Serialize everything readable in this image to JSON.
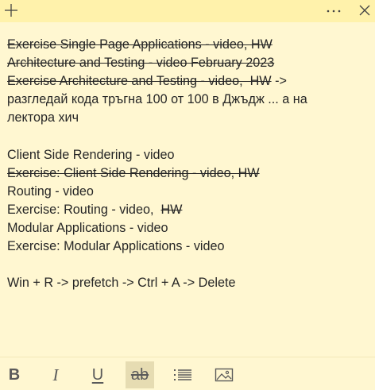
{
  "header": {
    "add_icon": "plus-icon",
    "more_icon": "ellipsis-icon",
    "close_icon": "close-icon"
  },
  "note": {
    "lines": [
      {
        "text": "Exercise Single Page Applications - video, HW",
        "strike": true
      },
      {
        "text": "Architecture and Testing - video February 2023",
        "strike": true
      },
      {
        "text_strike": "Exercise Architecture and Testing - video,  HW",
        "text_plain": " ->"
      },
      {
        "text": "разгледай кода тръгна 100 от 100 в Джъдж ... а на",
        "strike": false
      },
      {
        "text": "лектора хич",
        "strike": false
      },
      {
        "text": "",
        "strike": false
      },
      {
        "text": "Client Side Rendering - video",
        "strike": false
      },
      {
        "text": "Exercise: Client Side Rendering - video, HW",
        "strike": true
      },
      {
        "text": "Routing - video",
        "strike": false
      },
      {
        "text_plain": "Exercise: Routing - video,  ",
        "text_strike": "HW"
      },
      {
        "text": "Modular Applications - video",
        "strike": false
      },
      {
        "text": "Exercise: Modular Applications - video",
        "strike": false
      },
      {
        "text": "",
        "strike": false
      },
      {
        "text": "Win + R -> prefetch -> Ctrl + A -> Delete",
        "strike": false
      }
    ]
  },
  "toolbar": {
    "bold_label": "B",
    "italic_label": "I",
    "underline_label": "U",
    "strike_label": "ab",
    "list_icon": "bulleted-list-icon",
    "image_icon": "image-icon",
    "strike_active": true
  },
  "colors": {
    "note_background": "#fff7d1",
    "topbar_background": "#fff2ab",
    "text": "#262626",
    "active_button": "#e6dcb2"
  }
}
